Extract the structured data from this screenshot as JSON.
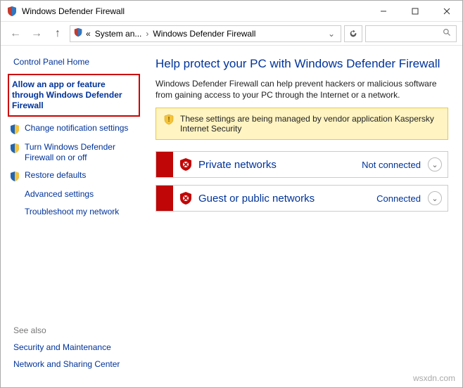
{
  "window": {
    "title": "Windows Defender Firewall"
  },
  "breadcrumb": {
    "root_symbol": "«",
    "items": [
      "System an...",
      "Windows Defender Firewall"
    ]
  },
  "sidebar": {
    "home": "Control Panel Home",
    "items": [
      {
        "label": "Allow an app or feature through Windows Defender Firewall"
      },
      {
        "label": "Change notification settings"
      },
      {
        "label": "Turn Windows Defender Firewall on or off"
      },
      {
        "label": "Restore defaults"
      },
      {
        "label": "Advanced settings"
      },
      {
        "label": "Troubleshoot my network"
      }
    ]
  },
  "see_also": {
    "header": "See also",
    "links": [
      "Security and Maintenance",
      "Network and Sharing Center"
    ]
  },
  "main": {
    "title": "Help protect your PC with Windows Defender Firewall",
    "description": "Windows Defender Firewall can help prevent hackers or malicious software from gaining access to your PC through the Internet or a network.",
    "warning": "These settings are being managed by vendor application Kaspersky Internet Security",
    "networks": [
      {
        "name": "Private networks",
        "status": "Not connected"
      },
      {
        "name": "Guest or public networks",
        "status": "Connected"
      }
    ]
  },
  "watermark": "wsxdn.com"
}
